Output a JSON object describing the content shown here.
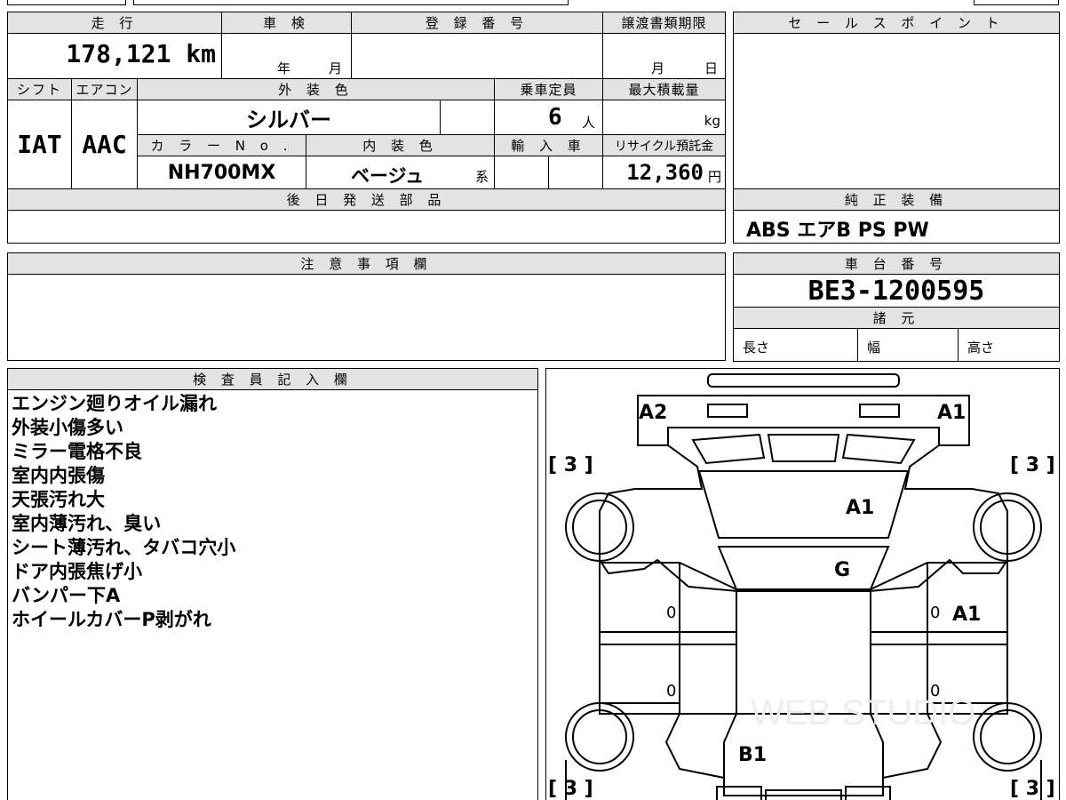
{
  "headers": {
    "mileage": "走 行",
    "inspection": "車 検",
    "registration": "登 録 番 号",
    "transfer_deadline": "譲渡書類期限",
    "shift": "シフト",
    "aircon": "エアコン",
    "exterior_color": "外 装 色",
    "capacity": "乗車定員",
    "max_load": "最大積載量",
    "color_no": "カ ラ ー N o .",
    "interior_color": "内 装 色",
    "import": "輸 入 車",
    "recycle": "リサイクル預託金",
    "later_parts": "後 日 発 送 部 品",
    "sales_point": "セ ー ル ス ポ イ ン ト",
    "genuine_equipment": "純 正 装 備",
    "notes": "注 意 事 項 欄",
    "chassis_no": "車 台 番 号",
    "specs": "諸 元",
    "inspector": "検 査 員 記 入 欄"
  },
  "vehicle": {
    "mileage": "178,121 km",
    "inspection_year_unit": "年",
    "inspection_month_unit": "月",
    "deadline_month_unit": "月",
    "deadline_day_unit": "日",
    "shift": "IAT",
    "aircon": "AAC",
    "exterior_color": "シルバー",
    "capacity": "6",
    "capacity_unit": "人",
    "max_load_unit": "kg",
    "color_no": "NH700MX",
    "interior_color": "ベージュ",
    "interior_suffix": "系",
    "recycle_fee": "12,360",
    "recycle_unit": "円",
    "equipment": "ABS エアB PS PW",
    "chassis_no": "BE3-1200595",
    "spec_length": "長さ",
    "spec_width": "幅",
    "spec_height": "高さ"
  },
  "inspector_notes": [
    "エンジン廻りオイル漏れ",
    "外装小傷多い",
    "ミラー電格不良",
    "室内内張傷",
    "天張汚れ大",
    "室内薄汚れ、臭い",
    "シート薄汚れ、タバコ穴小",
    "ドア内張焦げ小",
    "バンパー下A",
    "ホイールカバーP剥がれ"
  ],
  "diagram_marks": {
    "front_left": "A2",
    "front_right": "A1",
    "bonnet": "A1",
    "windshield": "G",
    "right_doors": "A1",
    "rear": "B1",
    "tire_fl": "[ 3 ]",
    "tire_fr": "[ 3 ]",
    "tire_rl": "[ 3 ]",
    "tire_rr": "[ 3 ]",
    "door_mark_1": "0",
    "door_mark_2": "0",
    "door_mark_3": "0",
    "door_mark_4": "0"
  }
}
